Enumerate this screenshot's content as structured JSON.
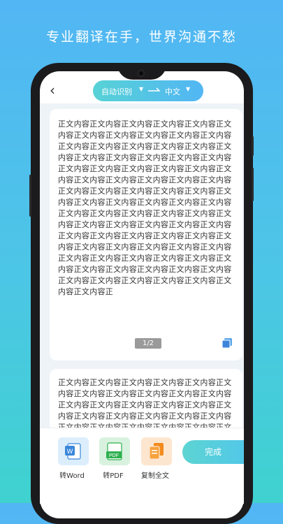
{
  "headline": "专业翻译在手，世界沟通不愁",
  "nav": {
    "back_symbol": "‹",
    "source_language": "自动识别",
    "target_language": "中文"
  },
  "document": {
    "page1_text": "正文内容正文内容正文内容正文内容正文内容正文内容正文内容正文内容正文内容正文内容正文内容正文内容正文内容正文内容正文内容正文内容正文内容正文内容正文内容正文内容正文内容正文内容正文内容正文内容正文内容正文内容正文内容正文内容正文内容正文内容正文内容正文内容正文内容正文内容正文内容正文内容正文内容正文内容正文内容正文内容正文内容正文内容正文内容正文内容正文内容正文内容正文内容正文内容正文内容正文内容正文内容正文内容正文内容正文内容正文内容正文内容正文内容正文内容正文内容正文内容正文内容正文内容正文内容正文内容正文内容正文内容正文内容正文内容正文内容正文内容正文内容正文内容正文内容正文内容正文内容正文内容正文内容正文内容正文内容正文内容正文内容正文内容正文内容正文内容正",
    "page_indicator": "1/2",
    "page2_text": "正文内容正文内容正文内容正文内容正文内容正文内容正文内容正文内容正文内容正文内容正文内容正文内容正文内容正文内容正文内容正文内容正文内容正文内容正文内容正文内容正文内容正文内容正文内容正文内容正文内容正文内容正文内容正文内容正文内容正文内容"
  },
  "toolbar": {
    "word_label": "转Word",
    "pdf_label": "转PDF",
    "copy_label": "复制全文",
    "done_label": "完成",
    "word_icon_text": "W",
    "pdf_icon_text": "PDF"
  },
  "colors": {
    "word_bg": "#dceefc",
    "pdf_bg": "#d8f2df",
    "copy_bg": "#fde6cf"
  }
}
